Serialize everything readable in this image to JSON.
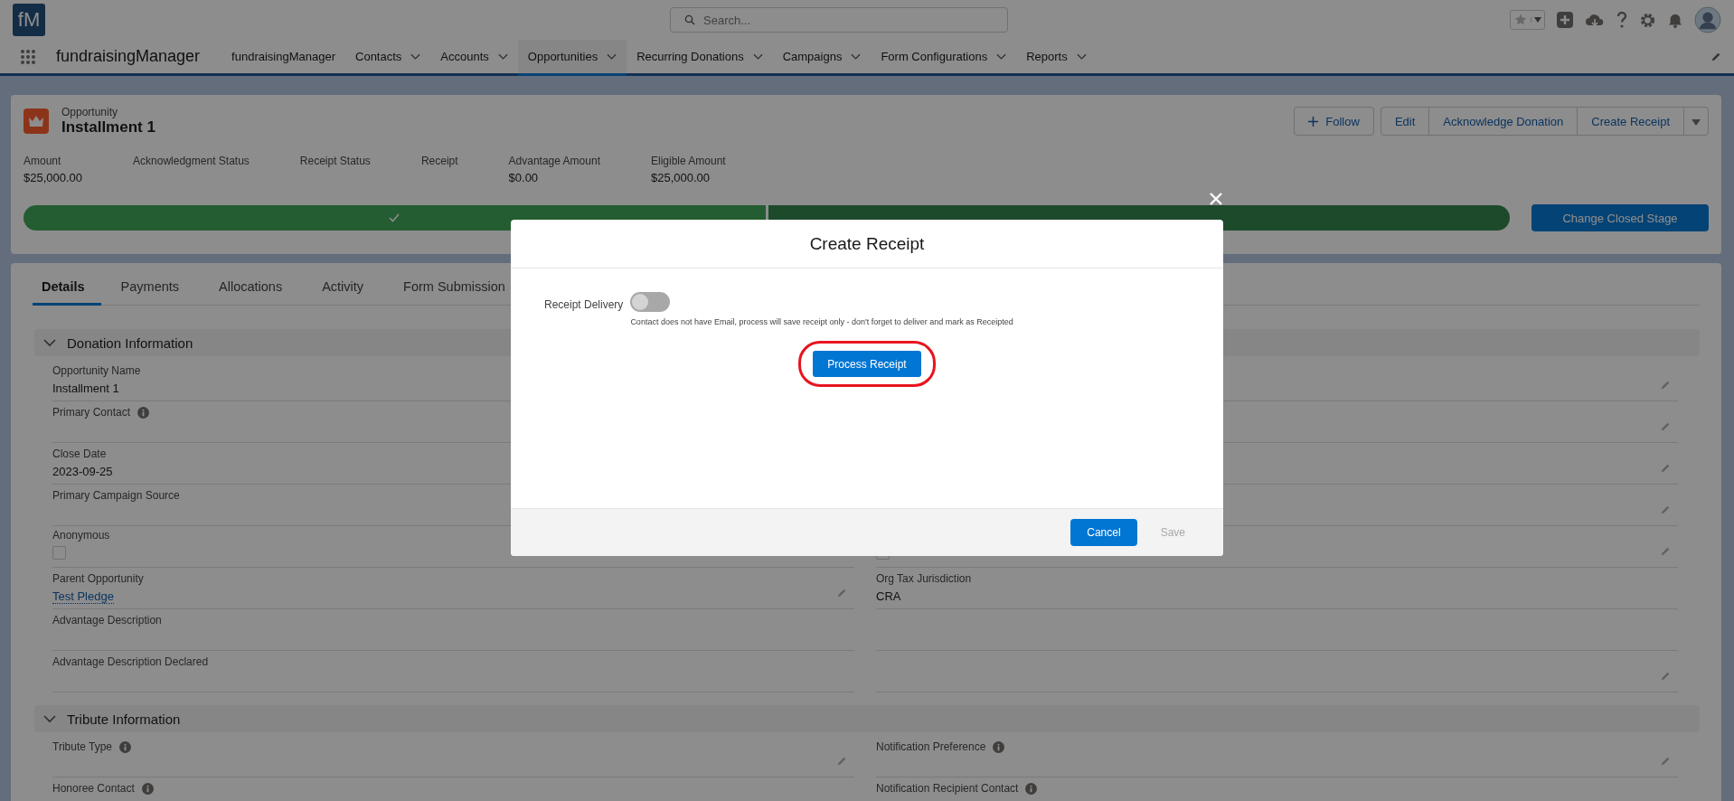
{
  "app_header": {
    "logo": "fM",
    "search": {
      "placeholder": "Search..."
    }
  },
  "nav": {
    "app_name": "fundraisingManager",
    "items": [
      {
        "label": "fundraisingManager",
        "menu": false,
        "selected": false
      },
      {
        "label": "Contacts",
        "menu": true,
        "selected": false
      },
      {
        "label": "Accounts",
        "menu": true,
        "selected": false
      },
      {
        "label": "Opportunities",
        "menu": true,
        "selected": true
      },
      {
        "label": "Recurring Donations",
        "menu": true,
        "selected": false
      },
      {
        "label": "Campaigns",
        "menu": true,
        "selected": false
      },
      {
        "label": "Form Configurations",
        "menu": true,
        "selected": false
      },
      {
        "label": "Reports",
        "menu": true,
        "selected": false
      }
    ]
  },
  "record": {
    "type": "Opportunity",
    "title": "Installment 1",
    "actions": [
      {
        "label": "Follow",
        "kind": "follow"
      },
      {
        "label": "Edit",
        "kind": "button"
      },
      {
        "label": "Acknowledge Donation",
        "kind": "button"
      },
      {
        "label": "Create Receipt",
        "kind": "button"
      },
      {
        "kind": "menu"
      }
    ],
    "highlights": [
      {
        "label": "Amount",
        "value": "$25,000.00"
      },
      {
        "label": "Acknowledgment Status"
      },
      {
        "label": "Receipt Status"
      },
      {
        "label": "Receipt"
      },
      {
        "label": "Advantage Amount",
        "value": "$0.00"
      },
      {
        "label": "Eligible Amount",
        "value": "$25,000.00"
      }
    ]
  },
  "path": {
    "stages": [
      {
        "completed": true
      },
      {
        "completed": false
      }
    ],
    "button": "Change Closed Stage"
  },
  "tabs": [
    {
      "label": "Details",
      "selected": true
    },
    {
      "label": "Payments",
      "selected": false
    },
    {
      "label": "Allocations",
      "selected": false
    },
    {
      "label": "Activity",
      "selected": false
    },
    {
      "label": "Form Submission",
      "selected": false
    }
  ],
  "sections": [
    {
      "title": "Donation Information",
      "expanded": true,
      "fields": [
        {
          "label": "Opportunity Name",
          "kind": "text",
          "value": "Installment 1",
          "info": false
        },
        {
          "kind": "empty",
          "editable": true
        },
        {
          "label": "Primary Contact",
          "kind": "text",
          "info": true
        },
        {
          "kind": "empty",
          "editable": true
        },
        {
          "label": "Close Date",
          "kind": "text",
          "value": "2023-09-25",
          "info": false
        },
        {
          "kind": "empty",
          "editable": true
        },
        {
          "label": "Primary Campaign Source",
          "kind": "text",
          "info": false
        },
        {
          "kind": "empty",
          "editable": true
        },
        {
          "label": "Anonymous",
          "kind": "checkbox",
          "checked": false,
          "info": false
        },
        {
          "kind": "checkbox",
          "checked": false,
          "editable": true
        },
        {
          "label": "Parent Opportunity",
          "kind": "link",
          "value": "Test Pledge",
          "info": false,
          "editable": true
        },
        {
          "label": "Org Tax Jurisdiction",
          "kind": "text",
          "value": "CRA",
          "info": false,
          "editable": false
        },
        {
          "label": "Advantage Description",
          "kind": "text",
          "info": false,
          "editable": false
        },
        {
          "kind": "empty",
          "editable": false
        },
        {
          "label": "Advantage Description Declared",
          "kind": "text",
          "info": false,
          "editable": false
        },
        {
          "kind": "empty",
          "editable": true
        }
      ]
    },
    {
      "title": "Tribute Information",
      "expanded": true,
      "fields": [
        {
          "label": "Tribute Type",
          "kind": "text",
          "info": true,
          "editable": true
        },
        {
          "label": "Notification Preference",
          "kind": "text",
          "info": true,
          "editable": true
        },
        {
          "label": "Honoree Contact",
          "kind": "text",
          "info": true,
          "editable": false
        },
        {
          "label": "Notification Recipient Contact",
          "kind": "text",
          "info": true,
          "editable": false
        }
      ]
    }
  ],
  "modal": {
    "title": "Create Receipt",
    "toggle": {
      "label": "Receipt Delivery",
      "on": false
    },
    "help": "Contact does not have Email, process will save receipt only - don't forget to deliver and mark as Receipted",
    "primary": {
      "label": "Process Receipt",
      "circled": true
    },
    "buttons": [
      {
        "label": "Cancel",
        "disabled": false
      },
      {
        "label": "Save",
        "disabled": true
      }
    ]
  }
}
